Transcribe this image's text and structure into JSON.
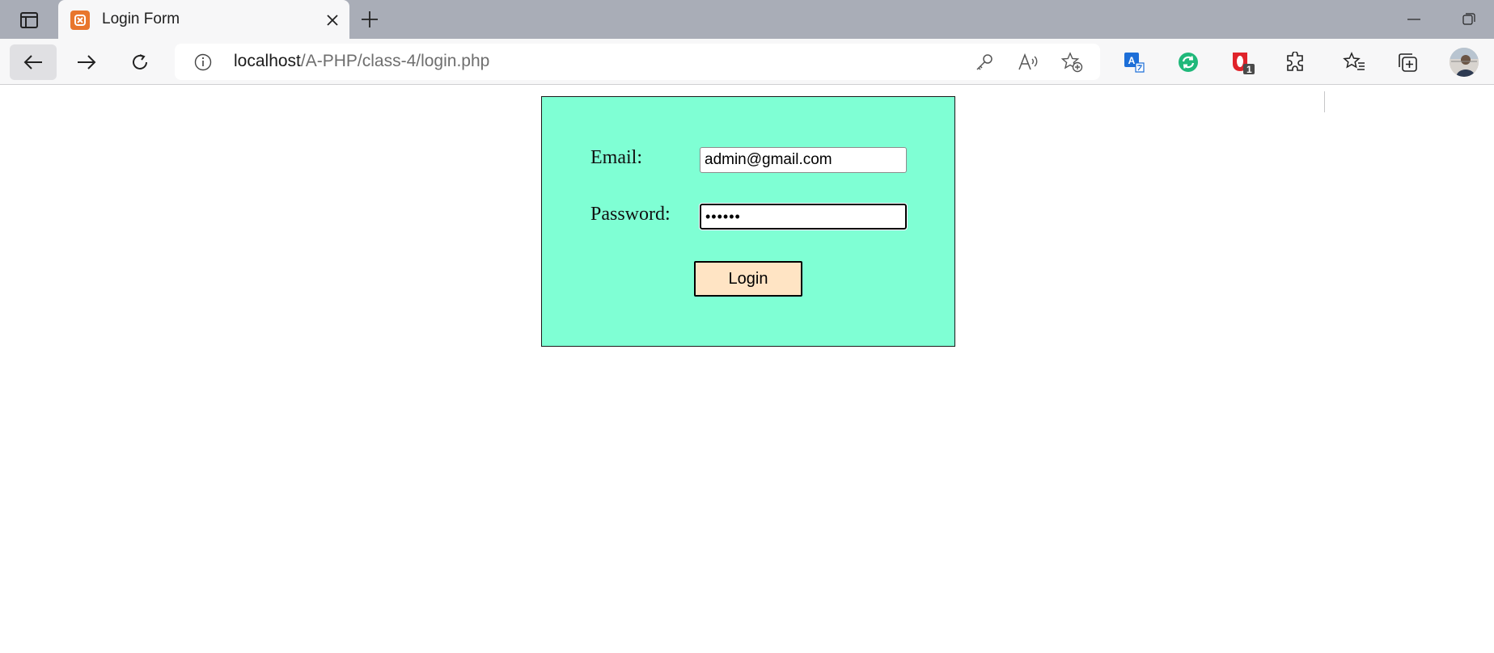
{
  "browser": {
    "tab": {
      "title": "Login Form"
    },
    "address_bar": {
      "host": "localhost",
      "path": "/A-PHP/class-4/login.php"
    },
    "extensions": {
      "opera_badge": "1"
    },
    "icons": {
      "tab_actions": "tab-actions-icon",
      "favicon": "xampp-favicon-icon",
      "close": "close-icon",
      "new_tab": "plus-icon",
      "minimize": "minimize-icon",
      "restore": "restore-icon",
      "back": "back-arrow-icon",
      "forward": "forward-arrow-icon",
      "reload": "reload-icon",
      "site_info": "info-icon",
      "password": "key-icon",
      "read_aloud": "read-aloud-icon",
      "add_favorite": "star-plus-icon",
      "translate": "translate-icon",
      "ext_green": "green-sync-extension-icon",
      "ext_opera": "opera-extension-icon",
      "extensions": "puzzle-icon",
      "favorites": "favorites-icon",
      "collections": "collections-icon",
      "profile": "avatar"
    }
  },
  "form": {
    "email_label": "Email:",
    "email_value": "admin@gmail.com",
    "password_label": "Password:",
    "password_value": "••••••",
    "login_button": "Login",
    "colors": {
      "panel_background": "#7fffd4",
      "button_background": "#ffe4c4"
    }
  }
}
